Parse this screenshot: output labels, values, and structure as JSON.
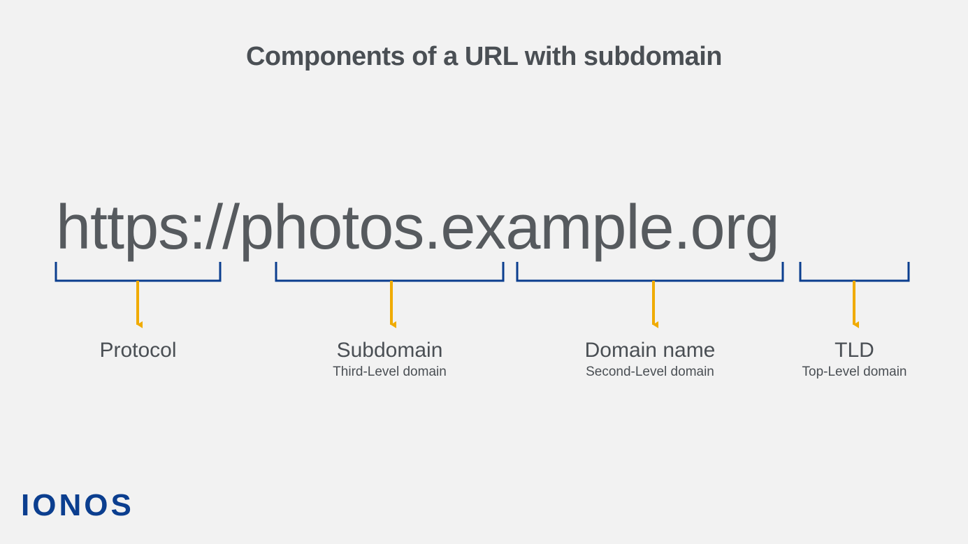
{
  "title": "Components of a URL with subdomain",
  "url": "https://photos.example.org",
  "chart_data": {
    "type": "table",
    "title": "Components of a URL with subdomain",
    "components": [
      {
        "segment": "https",
        "label": "Protocol",
        "sublabel": ""
      },
      {
        "segment": "photos",
        "label": "Subdomain",
        "sublabel": "Third-Level domain"
      },
      {
        "segment": "example",
        "label": "Domain name",
        "sublabel": "Second-Level domain"
      },
      {
        "segment": "org",
        "label": "TLD",
        "sublabel": "Top-Level domain"
      }
    ],
    "separators": [
      "://",
      ".",
      "."
    ]
  },
  "parts": {
    "protocol": {
      "main": "Protocol",
      "sub": ""
    },
    "subdomain": {
      "main": "Subdomain",
      "sub": "Third-Level domain"
    },
    "domainname": {
      "main": "Domain name",
      "sub": "Second-Level domain"
    },
    "tld": {
      "main": "TLD",
      "sub": "Top-Level domain"
    }
  },
  "logo": "IONOS",
  "colors": {
    "bracket": "#0b3e8f",
    "arrow": "#f0ab00",
    "text": "#4a4f54",
    "logo": "#0b3e8f"
  }
}
